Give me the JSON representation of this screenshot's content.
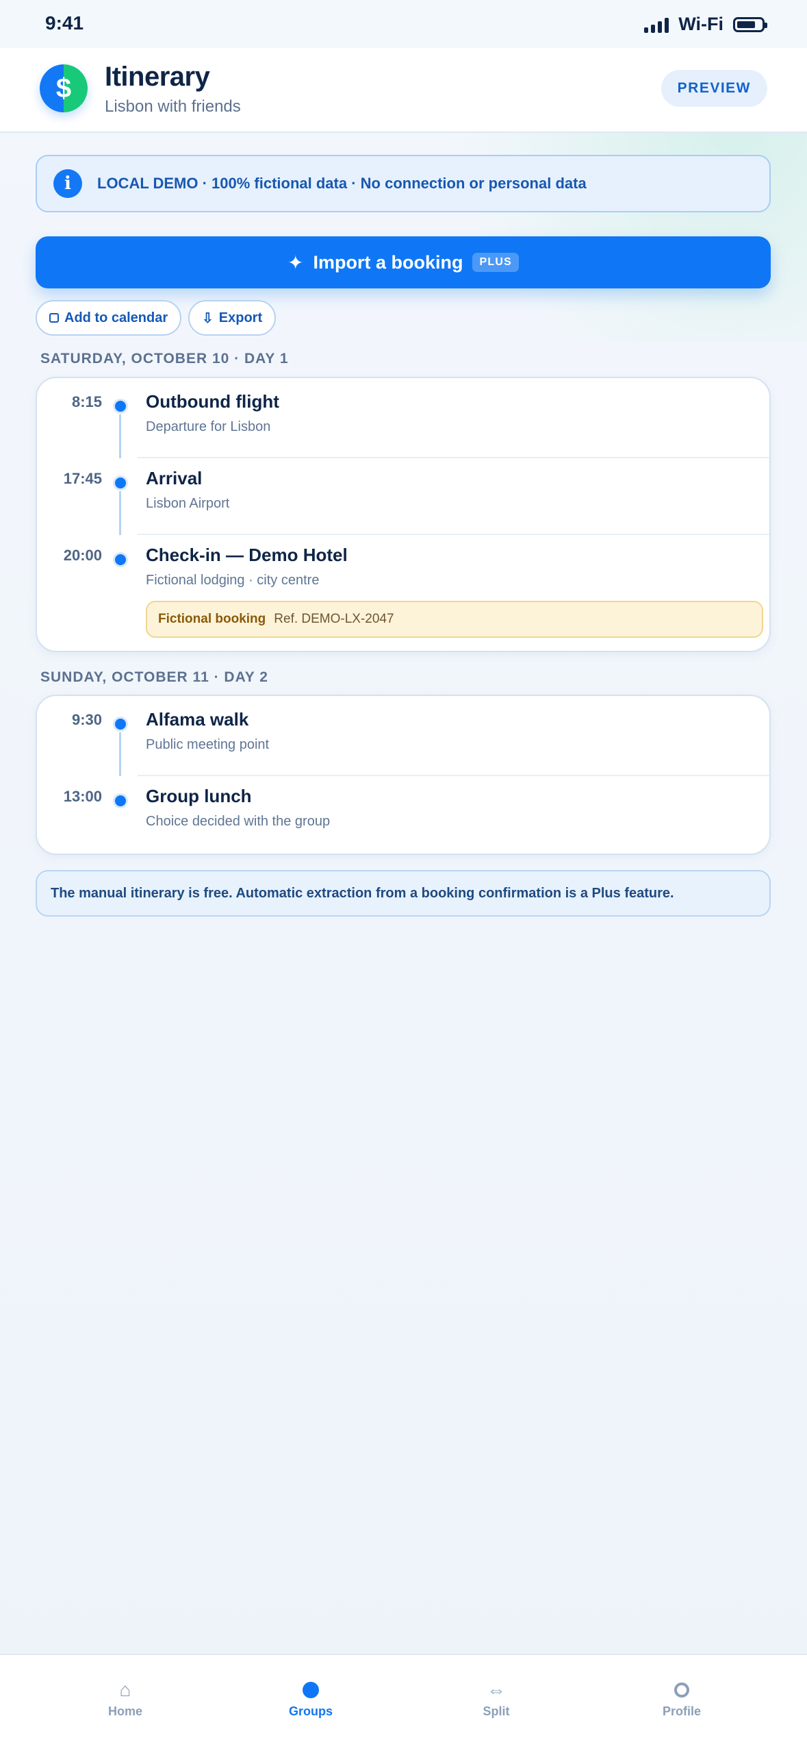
{
  "status_bar": {
    "time": "9:41",
    "network": "Wi-Fi"
  },
  "header": {
    "title": "Itinerary",
    "subtitle": "Lisbon with friends",
    "logo_symbol": "$",
    "preview_label": "PREVIEW"
  },
  "banner": {
    "icon": "i",
    "text": "LOCAL DEMO · 100% fictional data · No connection or personal data"
  },
  "import": {
    "icon": "✦",
    "label": "Import a booking",
    "badge": "PLUS"
  },
  "actions": {
    "calendar_label": "Add to calendar",
    "export_icon": "⇩",
    "export_label": "Export"
  },
  "days": [
    {
      "header": "SATURDAY, OCTOBER 10 · DAY 1",
      "events": [
        {
          "time": "8:15",
          "title": "Outbound flight",
          "subtitle": "Departure for Lisbon"
        },
        {
          "time": "17:45",
          "title": "Arrival",
          "subtitle": "Lisbon Airport"
        },
        {
          "time": "20:00",
          "title": "Check-in — Demo Hotel",
          "subtitle": "Fictional lodging · city centre",
          "booking": {
            "label": "Fictional booking",
            "ref": "Ref. DEMO-LX-2047"
          }
        }
      ]
    },
    {
      "header": "SUNDAY, OCTOBER 11 · DAY 2",
      "events": [
        {
          "time": "9:30",
          "title": "Alfama walk",
          "subtitle": "Public meeting point"
        },
        {
          "time": "13:00",
          "title": "Group lunch",
          "subtitle": "Choice decided with the group"
        }
      ]
    }
  ],
  "note": "The manual itinerary is free. Automatic extraction from a booking confirmation is a Plus feature.",
  "tabs": [
    {
      "icon": "⌂",
      "label": "Home",
      "active": false
    },
    {
      "icon": "",
      "label": "Groups",
      "active": true
    },
    {
      "icon": "⇔",
      "label": "Split",
      "active": false
    },
    {
      "icon": "",
      "label": "Profile",
      "active": false
    }
  ],
  "colors": {
    "accent": "#0f77f5",
    "success": "#19c97a",
    "booking_bg": "#fdf3d9"
  }
}
